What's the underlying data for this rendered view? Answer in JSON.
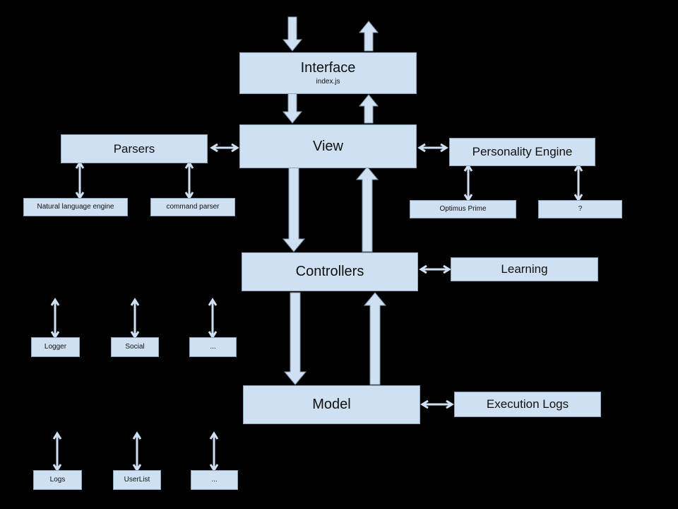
{
  "diagram": {
    "background_color": "#000000",
    "node_fill": "#cfe0f2",
    "node_border": "#8ba5bd",
    "arrow_color": "#cfe0f2",
    "nodes": {
      "interface": {
        "title": "Interface",
        "subtitle": "index.js"
      },
      "view": {
        "title": "View"
      },
      "parsers": {
        "title": "Parsers"
      },
      "personality": {
        "title": "Personality Engine"
      },
      "nl_engine": {
        "title": "Natural language engine"
      },
      "command_parser": {
        "title": "command parser"
      },
      "optimus_prime": {
        "title": "Optimus Prime"
      },
      "unknown_persona": {
        "title": "?"
      },
      "controllers": {
        "title": "Controllers"
      },
      "learning": {
        "title": "Learning"
      },
      "logger": {
        "title": "Logger"
      },
      "social": {
        "title": "Social"
      },
      "controller_more": {
        "title": "..."
      },
      "model": {
        "title": "Model"
      },
      "execution_logs": {
        "title": "Execution Logs"
      },
      "logs": {
        "title": "Logs"
      },
      "userlist": {
        "title": "UserList"
      },
      "model_more": {
        "title": "..."
      }
    }
  }
}
